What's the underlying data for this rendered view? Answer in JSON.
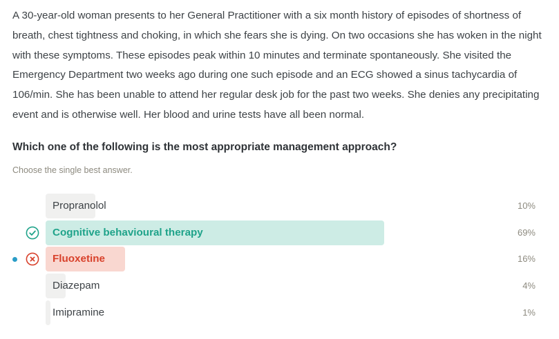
{
  "question": {
    "stem": "A 30-year-old woman presents to her General Practitioner with a six month history of episodes of shortness of breath, chest tightness and choking, in which she fears she is dying. On two occasions she has woken in the night with these symptoms. These episodes peak within 10 minutes and terminate spontaneously. She visited the Emergency Department two weeks ago during one such episode and an ECG showed a sinus tachycardia of 106/min. She has been unable to attend her regular desk job for the past two weeks. She denies any precipitating event and is otherwise well. Her blood and urine tests have all been normal.",
    "prompt": "Which one of the following is the most appropriate management approach?",
    "instruction": "Choose the single best answer."
  },
  "options": [
    {
      "label": "Propranolol",
      "percent_text": "10%",
      "percent": 10,
      "status": "neutral",
      "selected": false
    },
    {
      "label": "Cognitive behavioural therapy",
      "percent_text": "69%",
      "percent": 69,
      "status": "correct",
      "selected": false
    },
    {
      "label": "Fluoxetine",
      "percent_text": "16%",
      "percent": 16,
      "status": "incorrect",
      "selected": true
    },
    {
      "label": "Diazepam",
      "percent_text": "4%",
      "percent": 4,
      "status": "neutral",
      "selected": false
    },
    {
      "label": "Imipramine",
      "percent_text": "1%",
      "percent": 1,
      "status": "neutral",
      "selected": false
    }
  ],
  "colors": {
    "correct": "#1fa38a",
    "correct_bar": "#cdece5",
    "incorrect": "#d8412b",
    "incorrect_bar": "#f9d7d0",
    "neutral_bar": "#f0f0ef",
    "selected_dot": "#2a9dc7"
  },
  "icons": {
    "correct": "check-circle-icon",
    "incorrect": "x-circle-icon"
  }
}
